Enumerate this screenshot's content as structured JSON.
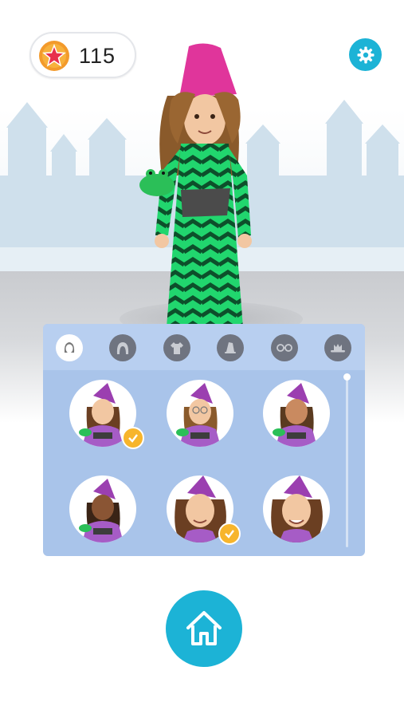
{
  "header": {
    "coin_count": "115",
    "coin_icon": "star-coin-icon",
    "settings_icon": "gear-icon"
  },
  "colors": {
    "accent": "#1cb3d6",
    "panel": "#a9c4ea",
    "panel_tabs": "#b8cff0",
    "check_badge": "#f7b52c",
    "hat": "#e0359b",
    "dress_green": "#1fd16a"
  },
  "customize_panel": {
    "tabs": [
      {
        "name": "face",
        "icon": "face-icon",
        "active": true
      },
      {
        "name": "hair",
        "icon": "hair-icon",
        "active": false
      },
      {
        "name": "outfit",
        "icon": "shirt-icon",
        "active": false
      },
      {
        "name": "hat",
        "icon": "hat-icon",
        "active": false
      },
      {
        "name": "glasses",
        "icon": "glasses-icon",
        "active": false
      },
      {
        "name": "accessory",
        "icon": "hat-brim-icon",
        "active": false
      }
    ],
    "options": [
      {
        "skin": "light",
        "selected": true
      },
      {
        "skin": "light-glasses",
        "selected": false
      },
      {
        "skin": "tan",
        "selected": false
      },
      {
        "skin": "dark",
        "selected": false
      },
      {
        "skin": "light-closeup",
        "selected": true
      },
      {
        "skin": "light-closeup-2",
        "selected": false
      }
    ]
  },
  "footer": {
    "home_icon": "home-icon"
  }
}
